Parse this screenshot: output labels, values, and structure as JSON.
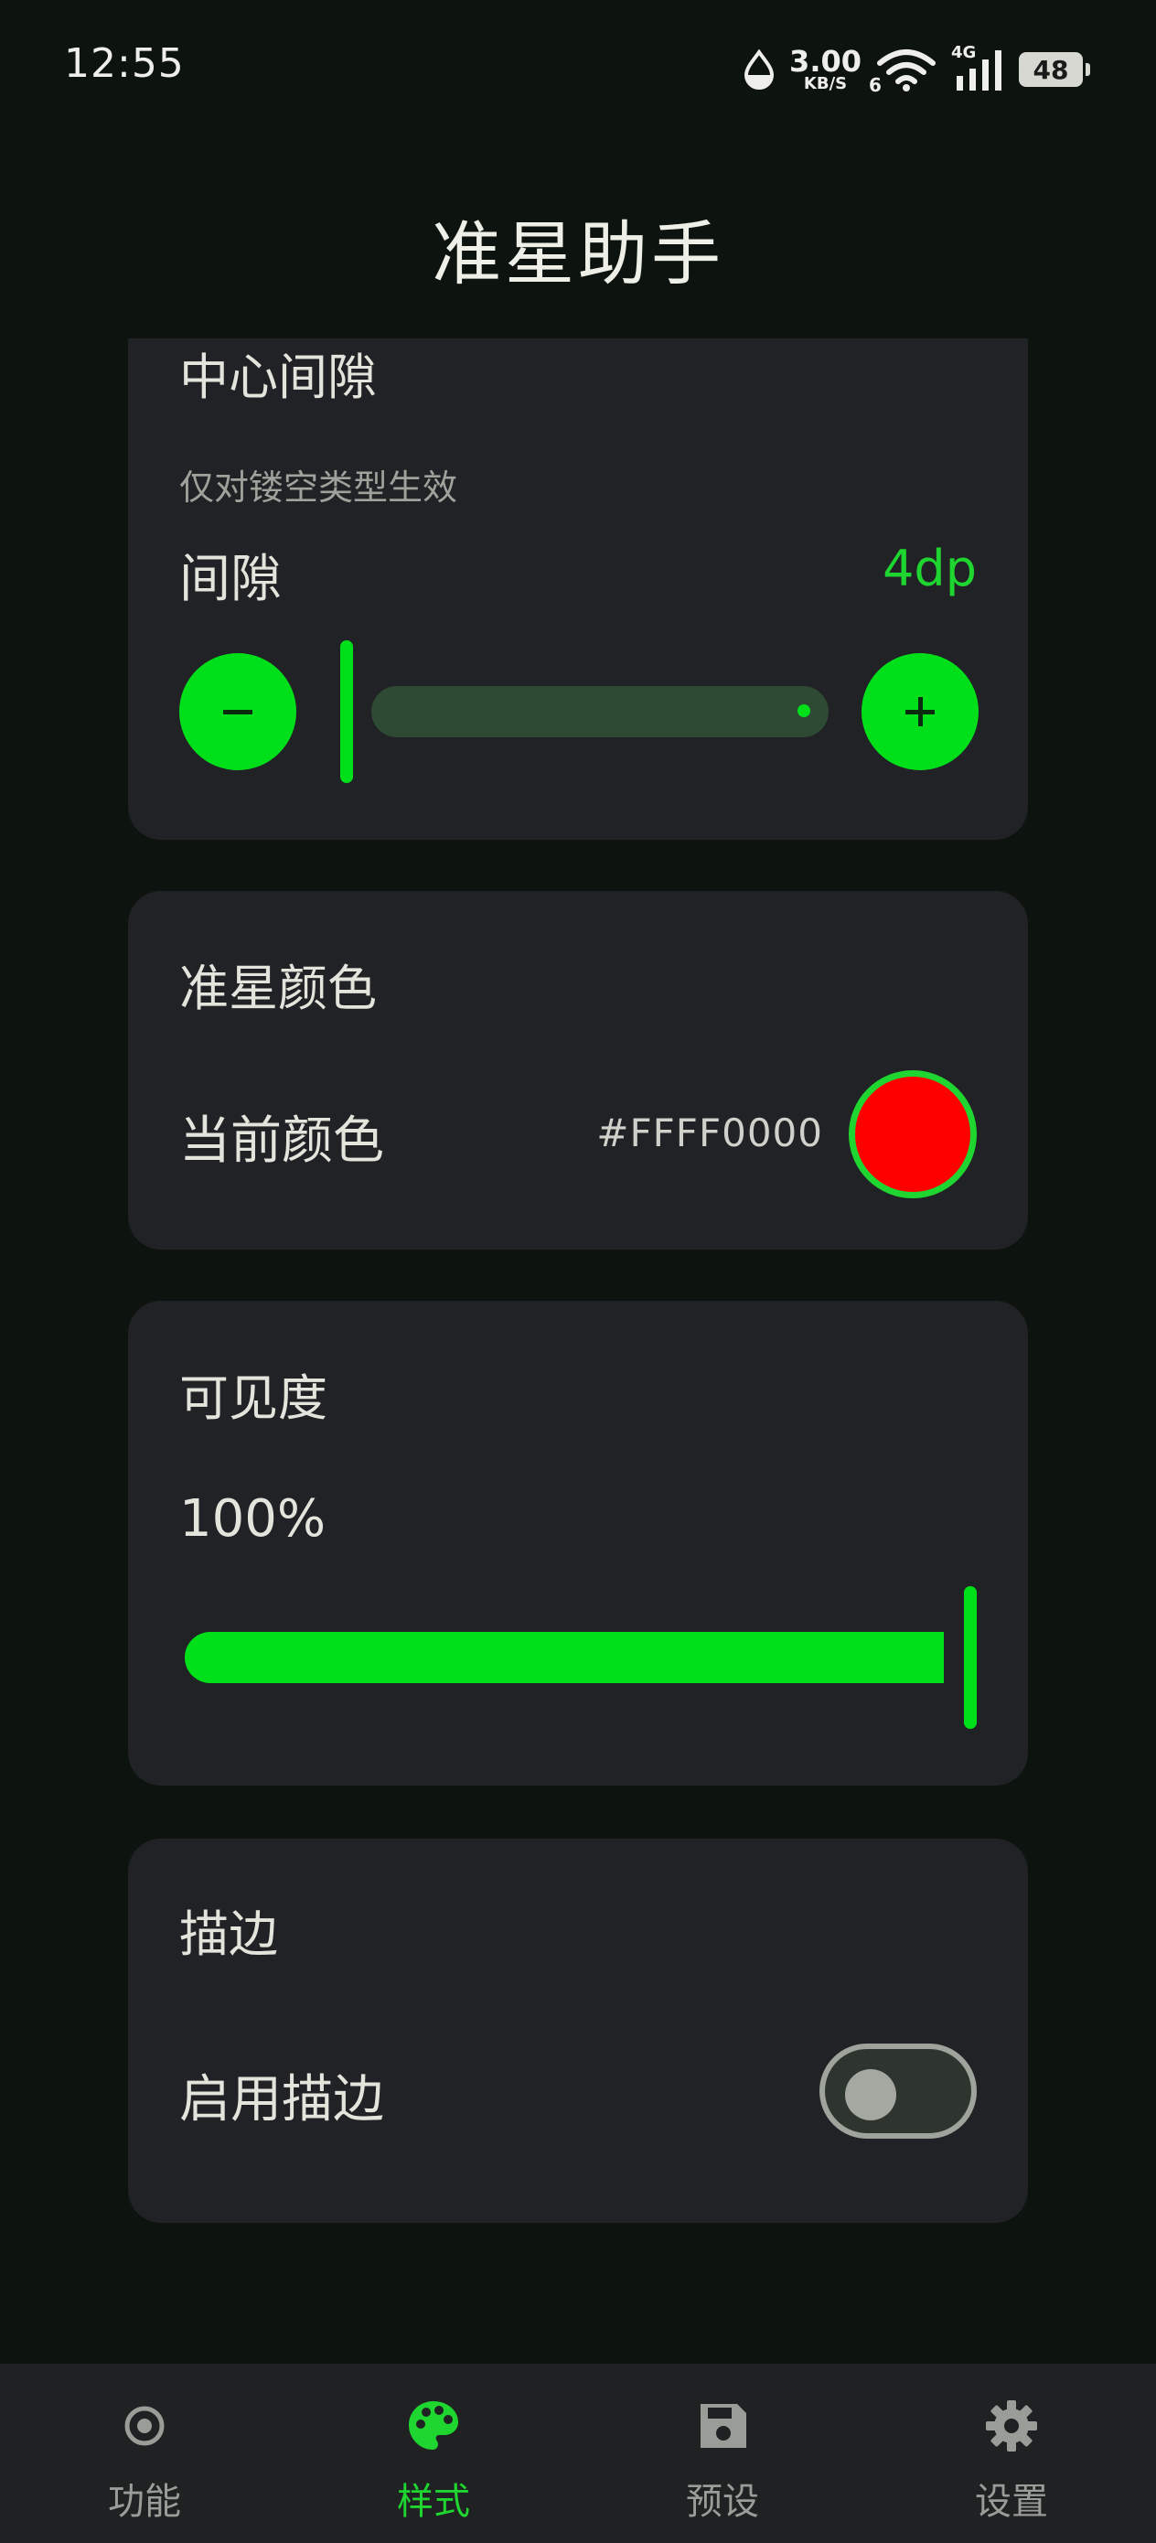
{
  "status_bar": {
    "time": "12:55",
    "net_speed": "3.00",
    "net_unit": "KB/S",
    "wifi_badge": "6",
    "cell_badge": "4G",
    "battery": "48",
    "icons": [
      "drop-icon",
      "wifi-icon",
      "cellular-signal-icon",
      "battery-icon"
    ]
  },
  "app": {
    "title": "准星助手"
  },
  "center_gap_card": {
    "title": "中心间隙",
    "hint": "仅对镂空类型生效",
    "label": "间隙",
    "value": "4dp",
    "level": 0.0,
    "minus_icon": "minus-icon",
    "plus_icon": "plus-icon"
  },
  "color_card": {
    "title": "准星颜色",
    "label": "当前颜色",
    "hex": "#FFFF0000",
    "swatch_color": "#ff0000",
    "ring_color": "#1fd52f"
  },
  "crosshair": {
    "color": "#d41414",
    "icon": "crosshair-icon"
  },
  "visibility_card": {
    "title": "可见度",
    "value": "100%",
    "level": 1.0
  },
  "outline_card": {
    "title": "描边",
    "label": "启用描边",
    "enabled": false
  },
  "bottom_nav": {
    "items": [
      {
        "label": "功能",
        "icon": "target-icon",
        "active": false
      },
      {
        "label": "样式",
        "icon": "palette-icon",
        "active": true
      },
      {
        "label": "预设",
        "icon": "save-icon",
        "active": false
      },
      {
        "label": "设置",
        "icon": "gear-icon",
        "active": false
      }
    ]
  },
  "colors": {
    "accent": "#00e01a",
    "accent_text": "#1fd52f",
    "background": "#0d140f",
    "card": "#212225"
  }
}
